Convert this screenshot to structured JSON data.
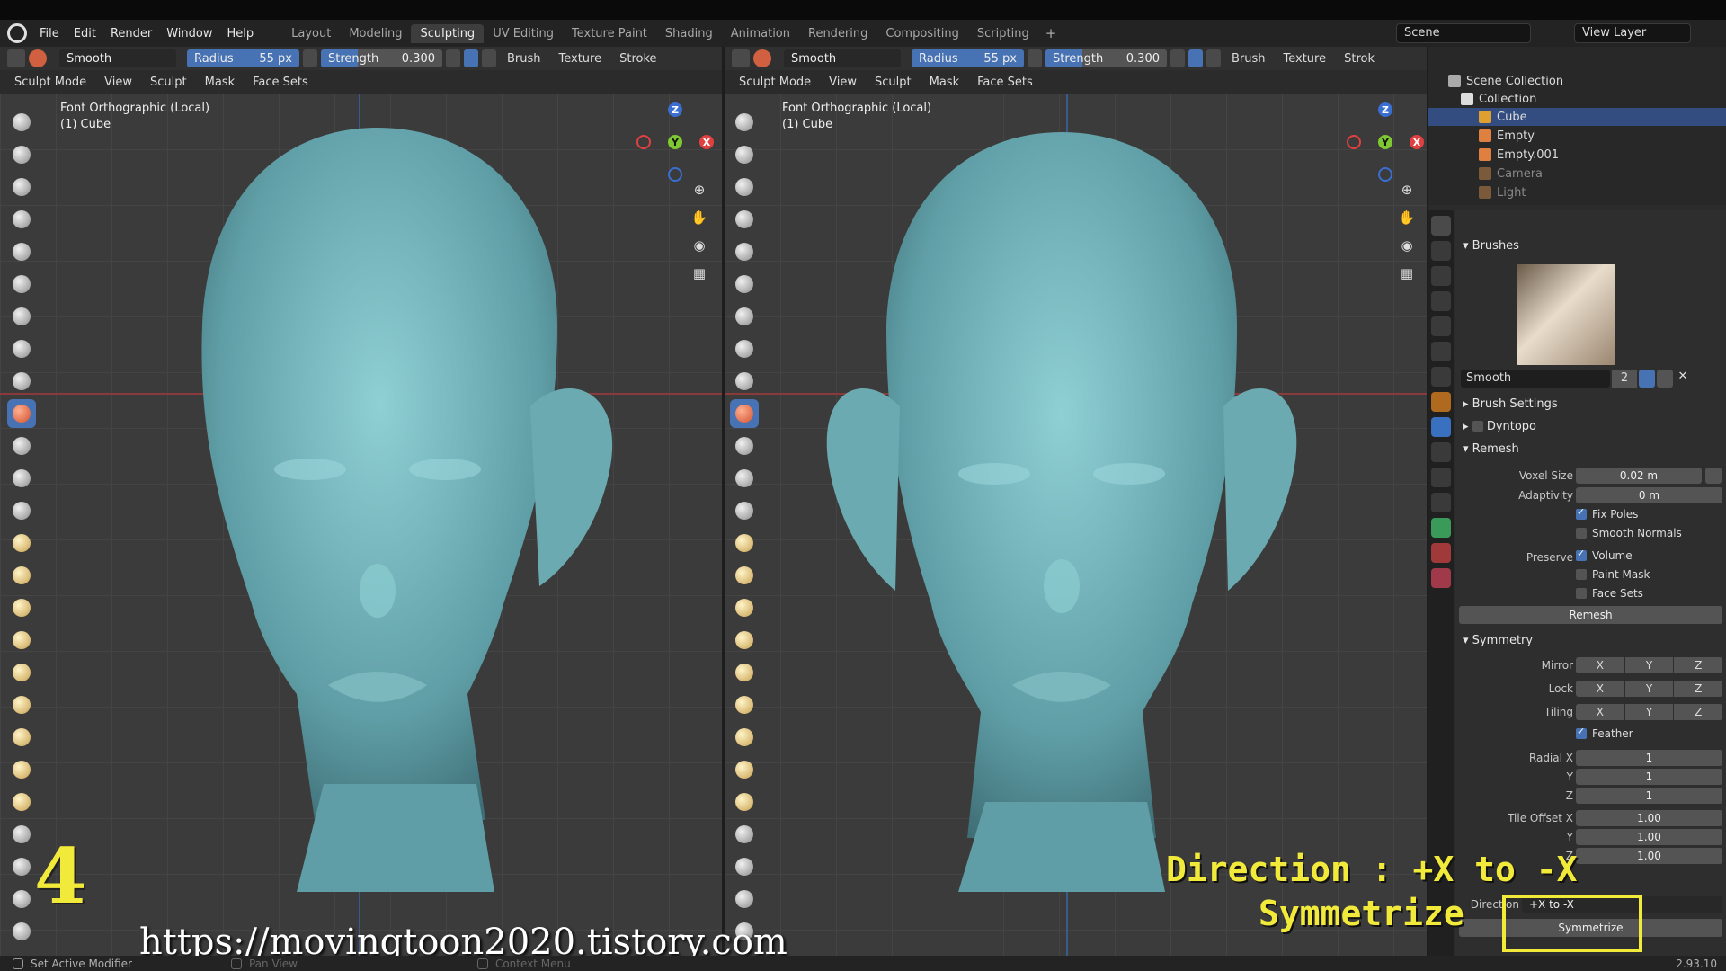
{
  "menu": [
    "File",
    "Edit",
    "Render",
    "Window",
    "Help"
  ],
  "workspaces": [
    "Layout",
    "Modeling",
    "Sculpting",
    "UV Editing",
    "Texture Paint",
    "Shading",
    "Animation",
    "Rendering",
    "Compositing",
    "Scripting"
  ],
  "active_workspace": "Sculpting",
  "add_tab": "+",
  "scene": "Scene",
  "view_layer": "View Layer",
  "viewport": {
    "brush_name": "Smooth",
    "radius_label": "Radius",
    "radius_value": "55 px",
    "strength_label": "Strength",
    "strength_value": "0.300",
    "strength_fraction": 0.3,
    "brush_menu": "Brush",
    "texture_menu": "Texture",
    "stroke_menu": "Stroke",
    "stroke_menu_cut": "Strok",
    "mode": "Sculpt Mode",
    "view": "View",
    "sculpt": "Sculpt",
    "mask": "Mask",
    "face_sets": "Face Sets",
    "label_line1": "Font Orthographic (Local)",
    "label_line2": "(1) Cube"
  },
  "gizmo": {
    "z": "Z",
    "y": "Y",
    "x": "X"
  },
  "outliner": {
    "root": "Scene Collection",
    "collection": "Collection",
    "items": [
      "Cube",
      "Empty",
      "Empty.001",
      "Camera",
      "Light"
    ]
  },
  "properties": {
    "brushes_header": "Brushes",
    "brush_name": "Smooth",
    "brush_users": "2",
    "brush_settings": "Brush Settings",
    "dyntopo": "Dyntopo",
    "remesh_header": "Remesh",
    "voxel_size_label": "Voxel Size",
    "voxel_size": "0.02 m",
    "adaptivity_label": "Adaptivity",
    "adaptivity": "0 m",
    "fix_poles": "Fix Poles",
    "smooth_normals": "Smooth Normals",
    "preserve_label": "Preserve",
    "volume": "Volume",
    "paint_mask": "Paint Mask",
    "face_sets": "Face Sets",
    "remesh_button": "Remesh",
    "symmetry_header": "Symmetry",
    "mirror_label": "Mirror",
    "lock_label": "Lock",
    "tiling_label": "Tiling",
    "axes": [
      "X",
      "Y",
      "Z"
    ],
    "feather": "Feather",
    "radial_x_label": "Radial X",
    "y_label": "Y",
    "z_label": "Z",
    "radial": [
      "1",
      "1",
      "1"
    ],
    "tile_offset_label": "Tile Offset X",
    "tile_offset": [
      "1.00",
      "1.00",
      "1.00"
    ],
    "direction_label": "Direction",
    "direction_value": "+X to -X",
    "symmetrize_button": "Symmetrize"
  },
  "status": {
    "left": "Set Active Modifier",
    "middle": "Pan View",
    "right": "Context Menu",
    "version": "2.93.10"
  },
  "overlay": {
    "step": "4",
    "direction_text": "Direction : +X to -X",
    "symmetrize_text": "Symmetrize",
    "url": "https://movingtoon2020.tistory.com"
  },
  "colors": {
    "accent": "#4772b3",
    "highlight": "#f2ea3a",
    "head": "#6fb2b8"
  }
}
